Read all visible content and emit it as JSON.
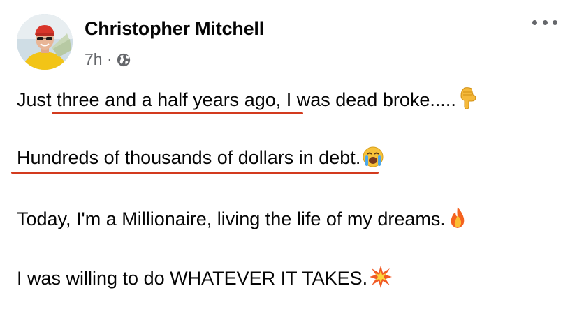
{
  "post": {
    "author": "Christopher Mitchell",
    "timestamp": "7h",
    "separator": "·",
    "privacy_icon": "globe-icon",
    "more_icon": "more-options-icon",
    "lines": [
      {
        "text": "Just three and a half years ago, I was dead broke.....",
        "emoji": "backhand-index-pointing-down"
      },
      {
        "text": "Hundreds of thousands of dollars in debt.",
        "emoji": "loudly-crying-face"
      },
      {
        "text": "Today, I'm a Millionaire, living the life of my dreams.",
        "emoji": "fire"
      },
      {
        "text": "I was willing to do WHATEVER IT TAKES.",
        "emoji": "collision"
      }
    ]
  },
  "colors": {
    "text": "#050505",
    "secondary_text": "#65676b",
    "underline_annotation": "#d33a1e"
  }
}
